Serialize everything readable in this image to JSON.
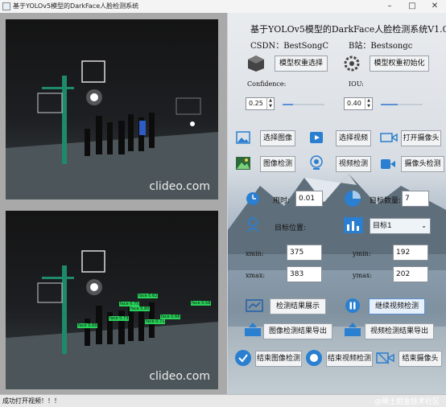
{
  "window": {
    "title": "基于YOLOv5模型的DarkFace人脸检测系统"
  },
  "video": {
    "watermark": "clideo.com"
  },
  "detections": [
    "face 0.69",
    "face 0.75",
    "face 0.62",
    "face 0.80",
    "face 0.71",
    "face 0.66",
    "face 0.58",
    "face 0.73"
  ],
  "panel": {
    "title": "基于YOLOv5模型的DarkFace人脸检测系统V1.0",
    "csdn": "CSDN：BestSongC",
    "bili": "B站：Bestsongc",
    "model_select": "模型权重选择",
    "model_init": "模型权重初始化",
    "confidence_label": "Confidence:",
    "confidence_value": "0.25",
    "confidence_level": 0.25,
    "iou_label": "IOU:",
    "iou_value": "0.40",
    "iou_level": 0.4,
    "select_image": "选择图像",
    "select_video": "选择视频",
    "open_camera": "打开摄像头",
    "image_detect": "图像检测",
    "video_detect": "视频检测",
    "camera_detect": "摄像头检测",
    "time_label": "用时:",
    "time_value": "0.01",
    "count_label": "目标数量:",
    "count_value": "7",
    "pos_label": "目标位置:",
    "target_select": "目标1",
    "xmin_label": "xmin:",
    "xmin_value": "375",
    "ymin_label": "ymin:",
    "ymin_value": "192",
    "xmax_label": "xmax:",
    "xmax_value": "383",
    "ymax_label": "ymax:",
    "ymax_value": "202",
    "show_results": "检测结果展示",
    "continue_video": "继续视频检测",
    "export_image": "图像检测结果导出",
    "export_video": "视频检测结果导出",
    "end_image": "结束图像检测",
    "end_video": "结束视频检测",
    "end_camera": "结束摄像头"
  },
  "status": {
    "text": "成功打开视频！！！",
    "watermark": "@稀土掘金技术社区"
  },
  "colors": {
    "accent": "#5b8fd6",
    "detect_box": "#28d35a",
    "title_bar": "#f4f4f4"
  }
}
